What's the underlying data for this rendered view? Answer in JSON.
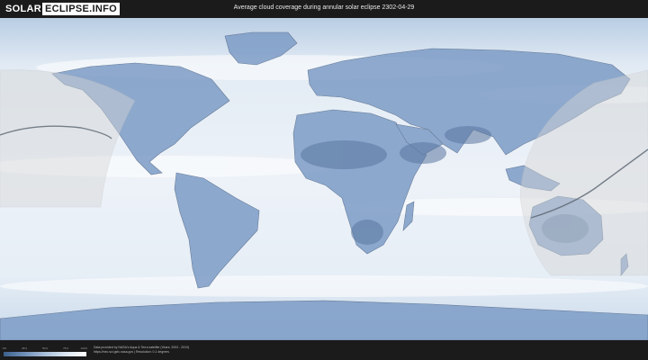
{
  "header": {
    "logo_left": "SOLAR",
    "logo_right": "ECLIPSE.INFO",
    "title": "Average cloud coverage during annular solar eclipse 2302-04-29"
  },
  "legend": {
    "ticks": [
      "0%",
      "25%",
      "50%",
      "75%",
      "100%"
    ],
    "colors": [
      "#3c5f8c",
      "#6f8fb8",
      "#a9bfd9",
      "#dce6f1",
      "#ffffff"
    ]
  },
  "credits": {
    "line1": "Data provided by NASA's Aqua & Terra satellite (Years: 2003 - 2019)",
    "line2": "https://neo.sci.gsfc.nasa.gov | Resolution: 0.1 degrees"
  },
  "map": {
    "projection": "equirectangular",
    "ocean_color": "#d9e5f1",
    "land_color": "#7d9cc6",
    "visibility_zone_color": "#d6d6d6",
    "eclipse_path_color": "#5a6470"
  }
}
